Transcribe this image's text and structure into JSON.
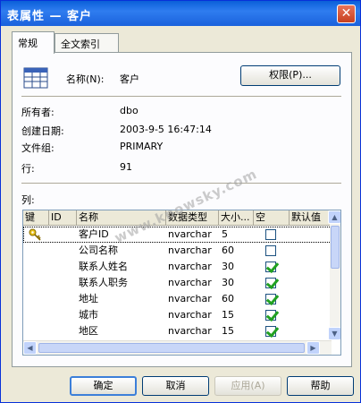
{
  "window": {
    "title": "表属性 — 客户",
    "close_glyph": "✕"
  },
  "tabs": [
    {
      "label": "常规",
      "active": true
    },
    {
      "label": "全文索引",
      "active": false
    }
  ],
  "general": {
    "name_label": "名称(N):",
    "name_value": "客户",
    "permissions_button": "权限(P)...",
    "props": [
      {
        "label": "所有者:",
        "value": "dbo"
      },
      {
        "label": "创建日期:",
        "value": "2003-9-5 16:47:14"
      },
      {
        "label": "文件组:",
        "value": "PRIMARY"
      },
      {
        "label": "行:",
        "value": "91"
      }
    ],
    "columns_label": "列:"
  },
  "columns_grid": {
    "headers": [
      "键",
      "ID",
      "名称",
      "数据类型",
      "大小...",
      "空",
      "默认值"
    ],
    "rows": [
      {
        "key": true,
        "name": "客户ID",
        "type": "nvarchar",
        "size": "5",
        "nullable": false
      },
      {
        "key": false,
        "name": "公司名称",
        "type": "nvarchar",
        "size": "60",
        "nullable": false
      },
      {
        "key": false,
        "name": "联系人姓名",
        "type": "nvarchar",
        "size": "30",
        "nullable": true
      },
      {
        "key": false,
        "name": "联系人职务",
        "type": "nvarchar",
        "size": "30",
        "nullable": true
      },
      {
        "key": false,
        "name": "地址",
        "type": "nvarchar",
        "size": "60",
        "nullable": true
      },
      {
        "key": false,
        "name": "城市",
        "type": "nvarchar",
        "size": "15",
        "nullable": true
      },
      {
        "key": false,
        "name": "地区",
        "type": "nvarchar",
        "size": "15",
        "nullable": true
      }
    ]
  },
  "buttons": {
    "ok": "确定",
    "cancel": "取消",
    "apply": "应用(A)",
    "help": "帮助"
  },
  "watermark": "www.knowsky.com",
  "colors": {
    "titlebar": "#0a5fd8",
    "check": "#21a121",
    "dialog_bg": "#ece9d8"
  }
}
